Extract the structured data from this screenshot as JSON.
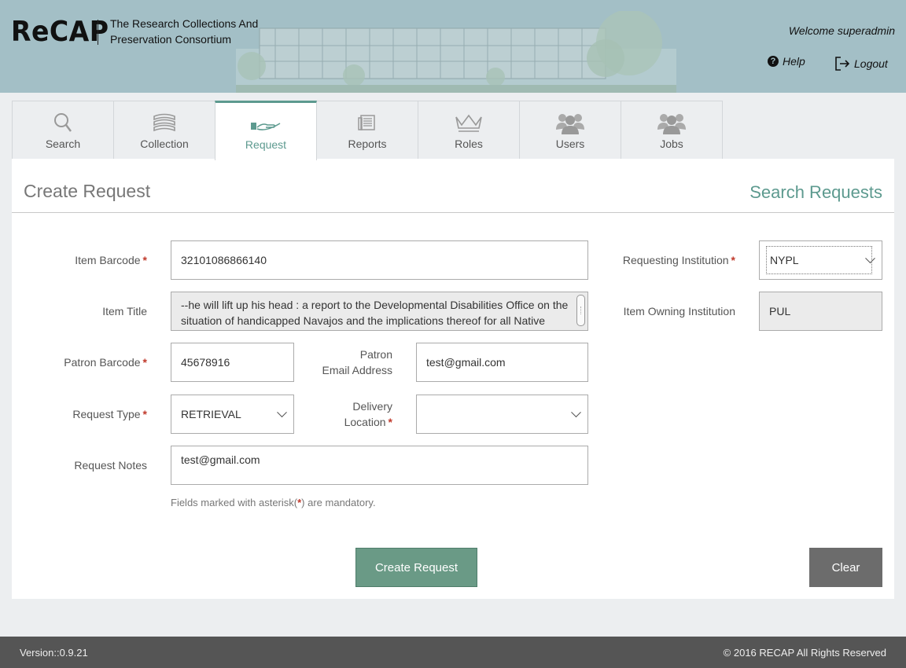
{
  "header": {
    "logo": "ReCAP",
    "subtitle_line1": "The Research Collections And",
    "subtitle_line2": "Preservation Consortium",
    "welcome": "Welcome superadmin",
    "help_label": "Help",
    "logout_label": "Logout"
  },
  "tabs": [
    {
      "label": "Search",
      "icon": "search-icon"
    },
    {
      "label": "Collection",
      "icon": "books-icon"
    },
    {
      "label": "Request",
      "icon": "hand-request-icon",
      "active": true
    },
    {
      "label": "Reports",
      "icon": "document-icon"
    },
    {
      "label": "Roles",
      "icon": "crown-icon"
    },
    {
      "label": "Users",
      "icon": "users-icon"
    },
    {
      "label": "Jobs",
      "icon": "users-icon"
    }
  ],
  "page": {
    "title": "Create Request",
    "search_requests_link": "Search Requests"
  },
  "form": {
    "item_barcode": {
      "label": "Item Barcode",
      "value": "32101086866140"
    },
    "item_title": {
      "label": "Item Title",
      "value": "--he will lift up his head : a report to the Developmental Disabilities Office on the situation of handicapped Navajos and the implications thereof for all Native Americans /"
    },
    "patron_barcode": {
      "label": "Patron Barcode",
      "value": "45678916"
    },
    "patron_email": {
      "label_line1": "Patron",
      "label_line2": "Email Address",
      "value": "test@gmail.com"
    },
    "request_type": {
      "label": "Request Type",
      "value": "RETRIEVAL"
    },
    "delivery_location": {
      "label_line1": "Delivery",
      "label_line2": "Location",
      "value": ""
    },
    "request_notes": {
      "label": "Request Notes",
      "value": "test@gmail.com"
    },
    "requesting_institution": {
      "label": "Requesting Institution",
      "value": "NYPL"
    },
    "item_owning_institution": {
      "label": "Item Owning Institution",
      "value": "PUL"
    },
    "required_marker": "*",
    "hint_before": "Fields marked with asterisk(",
    "hint_after": ") are mandatory."
  },
  "buttons": {
    "create": "Create Request",
    "clear": "Clear"
  },
  "footer": {
    "version": "Version::0.9.21",
    "copyright": "© 2016 RECAP All Rights Reserved"
  },
  "colors": {
    "header_bg": "#a3bfc6",
    "accent": "#5d9a8f",
    "create_button": "#6a9a86",
    "clear_button": "#6c6c6c",
    "required": "#c0392b",
    "footer_bg": "#555555"
  }
}
